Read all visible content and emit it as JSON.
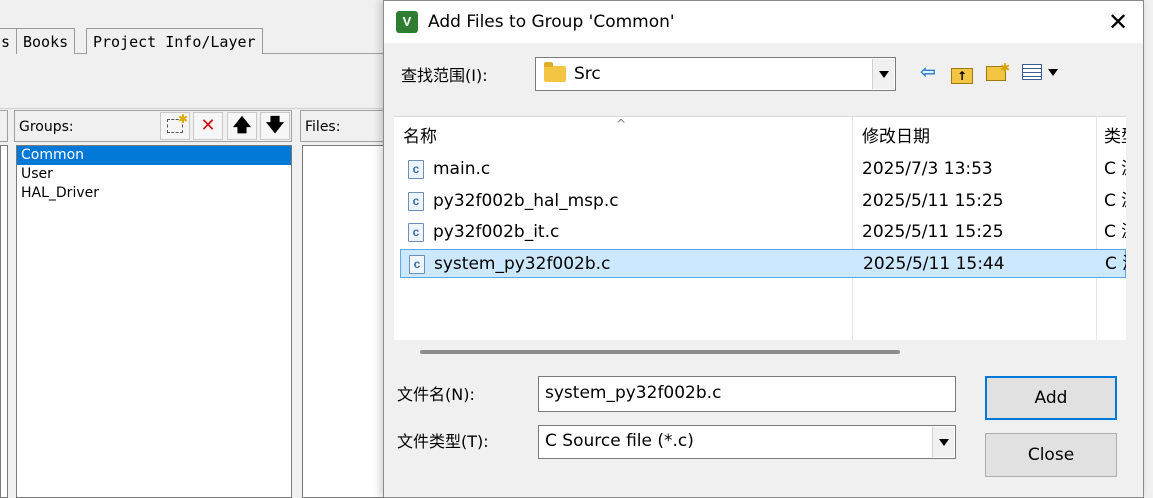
{
  "background": {
    "tabs": [
      "s",
      "Books",
      "Project Info/Layer"
    ],
    "groups_label": "Groups:",
    "files_label": "Files:",
    "groups": [
      "Common",
      "User",
      "HAL_Driver"
    ],
    "selected_group": "Common"
  },
  "dialog": {
    "title": "Add Files to Group 'Common'",
    "app_icon_text": "V",
    "look_in_label": "查找范围(I):",
    "look_in_value": "Src",
    "columns": {
      "name": "名称",
      "date": "修改日期",
      "type": "类型"
    },
    "files": [
      {
        "name": "main.c",
        "date": "2025/7/3 13:53",
        "type": "C 源"
      },
      {
        "name": "py32f002b_hal_msp.c",
        "date": "2025/5/11 15:25",
        "type": "C 源"
      },
      {
        "name": "py32f002b_it.c",
        "date": "2025/5/11 15:25",
        "type": "C 源"
      },
      {
        "name": "system_py32f002b.c",
        "date": "2025/5/11 15:44",
        "type": "C 源"
      }
    ],
    "selected_file": "system_py32f002b.c",
    "filename_label": "文件名(N):",
    "filename_value": "system_py32f002b.c",
    "filetype_label": "文件类型(T):",
    "filetype_value": "C Source file (*.c)",
    "add_label": "Add",
    "close_label": "Close"
  }
}
